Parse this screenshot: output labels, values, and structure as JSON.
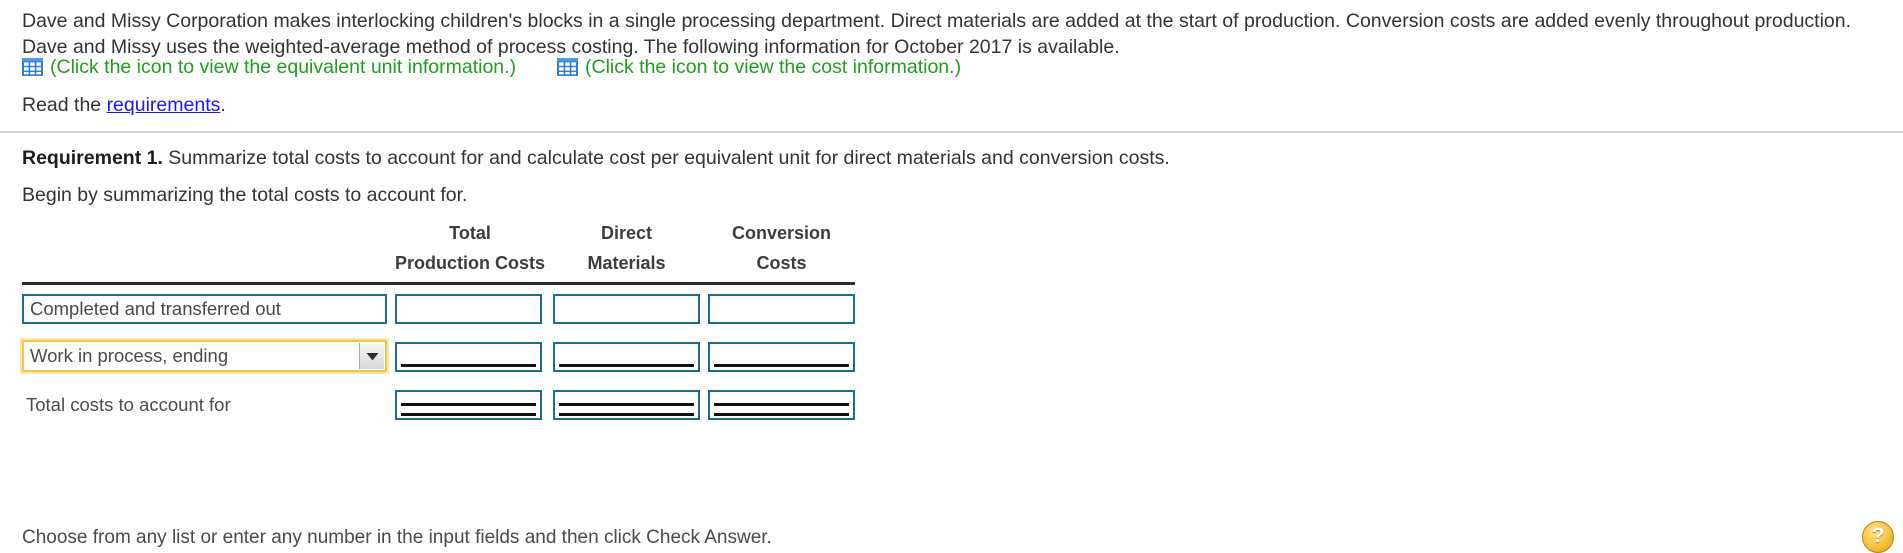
{
  "intro": {
    "paragraph": "Dave and Missy Corporation makes interlocking children's blocks in a single processing department. Direct materials are added at the start of production. Conversion costs are added evenly throughout production. Dave and Missy uses the weighted-average method of process costing. The following information for October 2017 is available."
  },
  "icon_links": [
    {
      "icon": "table-grid-icon",
      "label": "(Click the icon to view the equivalent unit information.)"
    },
    {
      "icon": "table-grid-icon",
      "label": "(Click the icon to view the cost information.)"
    }
  ],
  "read_line": {
    "prefix": "Read the ",
    "link": "requirements",
    "suffix": "."
  },
  "requirement": {
    "number_label": "Requirement 1.",
    "text": " Summarize total costs to account for and calculate cost per equivalent unit for direct materials and conversion costs.",
    "instruction": "Begin by summarizing the total costs to account for."
  },
  "table": {
    "headers": [
      {
        "line1": "Total",
        "line2": "Production Costs"
      },
      {
        "line1": "Direct",
        "line2": "Materials"
      },
      {
        "line1": "Conversion",
        "line2": "Costs"
      }
    ],
    "rows": [
      {
        "label": "Completed and transferred out",
        "label_type": "input",
        "rule": "none",
        "values": [
          "",
          "",
          ""
        ]
      },
      {
        "label": "Work in process, ending",
        "label_type": "select",
        "rule": "single",
        "values": [
          "",
          "",
          ""
        ]
      },
      {
        "label": "Total costs to account for",
        "label_type": "static",
        "rule": "double",
        "values": [
          "",
          "",
          ""
        ]
      }
    ]
  },
  "footer": {
    "note": "Choose from any list or enter any number in the input fields and then click Check Answer.",
    "help_label": "?"
  },
  "colors": {
    "link_green": "#1f9e1f",
    "link_blue": "#1a1af0",
    "input_border": "#1c6e8c",
    "focus_yellow": "#f2c54a",
    "icon_blue": "#2a7fd4",
    "help_gold": "#f3c33f"
  }
}
